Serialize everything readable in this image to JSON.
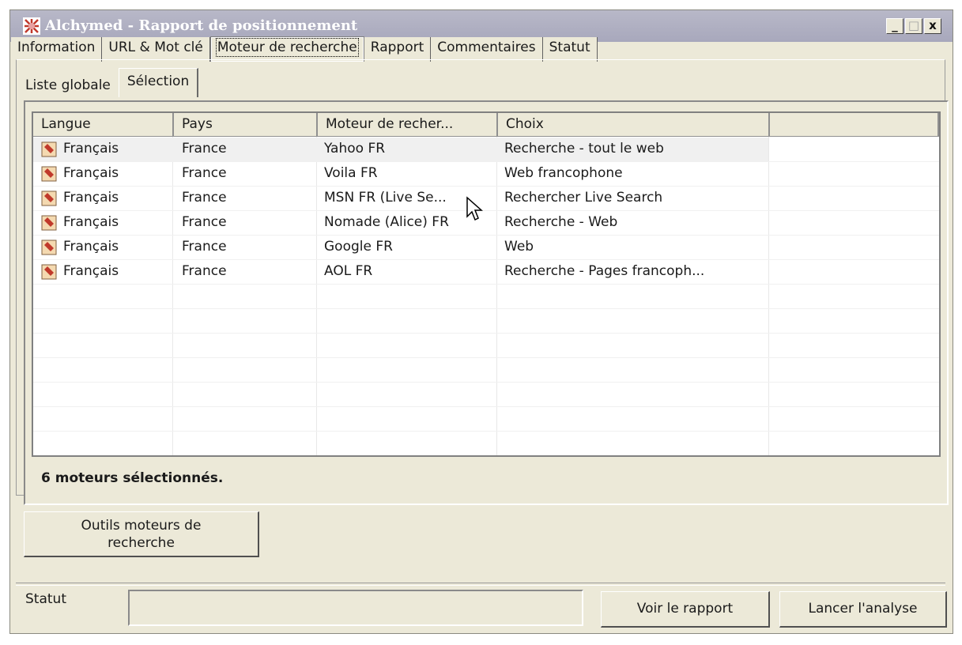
{
  "window": {
    "title": "Alchymed - Rapport de positionnement",
    "controls": [
      "_",
      "□",
      "x"
    ]
  },
  "tabs": [
    {
      "label": "Information",
      "active": false
    },
    {
      "label": "URL & Mot clé",
      "active": false
    },
    {
      "label": "Moteur de recherche",
      "active": true
    },
    {
      "label": "Rapport",
      "active": false
    },
    {
      "label": "Commentaires",
      "active": false
    },
    {
      "label": "Statut",
      "active": false
    }
  ],
  "subtabs": [
    {
      "label": "Liste globale",
      "active": false
    },
    {
      "label": "Sélection",
      "active": true
    }
  ],
  "list": {
    "columns": [
      "Langue",
      "Pays",
      "Moteur de recher...",
      "Choix",
      ""
    ],
    "rows": [
      {
        "langue": "Français",
        "pays": "France",
        "moteur": "Yahoo FR",
        "choix": "Recherche - tout le web"
      },
      {
        "langue": "Français",
        "pays": "France",
        "moteur": "Voila FR",
        "choix": "Web francophone"
      },
      {
        "langue": "Français",
        "pays": "France",
        "moteur": "MSN FR (Live Se...",
        "choix": "Rechercher Live Search"
      },
      {
        "langue": "Français",
        "pays": "France",
        "moteur": "Nomade (Alice) FR",
        "choix": "Recherche - Web"
      },
      {
        "langue": "Français",
        "pays": "France",
        "moteur": "Google FR",
        "choix": "Web"
      },
      {
        "langue": "Français",
        "pays": "France",
        "moteur": "AOL FR",
        "choix": "Recherche - Pages francoph..."
      }
    ],
    "row_icon": "language-flag-icon"
  },
  "count_text": "6 moteurs sélectionnés.",
  "buttons": {
    "outils_line1": "Outils moteurs de",
    "outils_line2": "recherche",
    "voir": "Voir le rapport",
    "lancer": "Lancer l'analyse"
  },
  "status": {
    "label": "Statut",
    "value": ""
  },
  "colors": {
    "window_bg": "#ece9d8",
    "titlebar": "#aeaec2",
    "icon_red": "#c0392b"
  }
}
